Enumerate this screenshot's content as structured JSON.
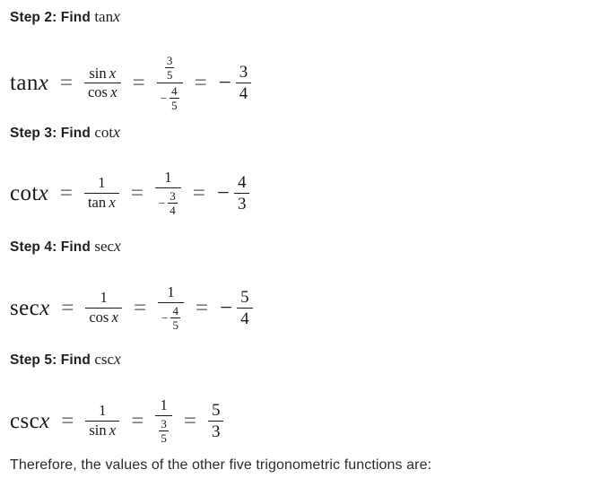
{
  "document": {
    "background_color": "#ffffff",
    "text_color": "#202124",
    "math_color": "#1a1a1a"
  },
  "blocks": {
    "step2": {
      "heading_prefix": "Step 2: Find",
      "heading_function": "tan",
      "heading_variable": "x"
    },
    "step3": {
      "heading_prefix": "Step 3: Find",
      "heading_function": "cot",
      "heading_variable": "x"
    },
    "step4": {
      "heading_prefix": "Step 4: Find",
      "heading_function": "sec",
      "heading_variable": "x"
    },
    "step5": {
      "heading_prefix": "Step 5: Find",
      "heading_function": "csc",
      "heading_variable": "x"
    }
  },
  "equations": {
    "tan": {
      "lhs_function": "tan",
      "lhs_variable": "x",
      "eq1": "=",
      "ratio_numerator_fn": "sin",
      "ratio_numerator_var": "x",
      "ratio_denominator_fn": "cos",
      "ratio_denominator_var": "x",
      "eq2": "=",
      "value_num_top": "3",
      "value_num_bottom": "5",
      "value_den_sign": "−",
      "value_den_top": "4",
      "value_den_bottom": "5",
      "eq3": "=",
      "result_sign": "−",
      "result_num": "3",
      "result_den": "4"
    },
    "cot": {
      "lhs_function": "cot",
      "lhs_variable": "x",
      "eq1": "=",
      "ratio_numerator": "1",
      "ratio_denominator_fn": "tan",
      "ratio_denominator_var": "x",
      "eq2": "=",
      "value_num": "1",
      "value_den_sign": "−",
      "value_den_top": "3",
      "value_den_bottom": "4",
      "eq3": "=",
      "result_sign": "−",
      "result_num": "4",
      "result_den": "3"
    },
    "sec": {
      "lhs_function": "sec",
      "lhs_variable": "x",
      "eq1": "=",
      "ratio_numerator": "1",
      "ratio_denominator_fn": "cos",
      "ratio_denominator_var": "x",
      "eq2": "=",
      "value_num": "1",
      "value_den_sign": "−",
      "value_den_top": "4",
      "value_den_bottom": "5",
      "eq3": "=",
      "result_sign": "−",
      "result_num": "5",
      "result_den": "4"
    },
    "csc": {
      "lhs_function": "csc",
      "lhs_variable": "x",
      "eq1": "=",
      "ratio_numerator": "1",
      "ratio_denominator_fn": "sin",
      "ratio_denominator_var": "x",
      "eq2": "=",
      "value_num": "1",
      "value_den_top": "3",
      "value_den_bottom": "5",
      "eq3": "=",
      "result_num": "5",
      "result_den": "3"
    }
  },
  "closing": {
    "text": "Therefore, the values of the other five trigonometric functions are:"
  }
}
